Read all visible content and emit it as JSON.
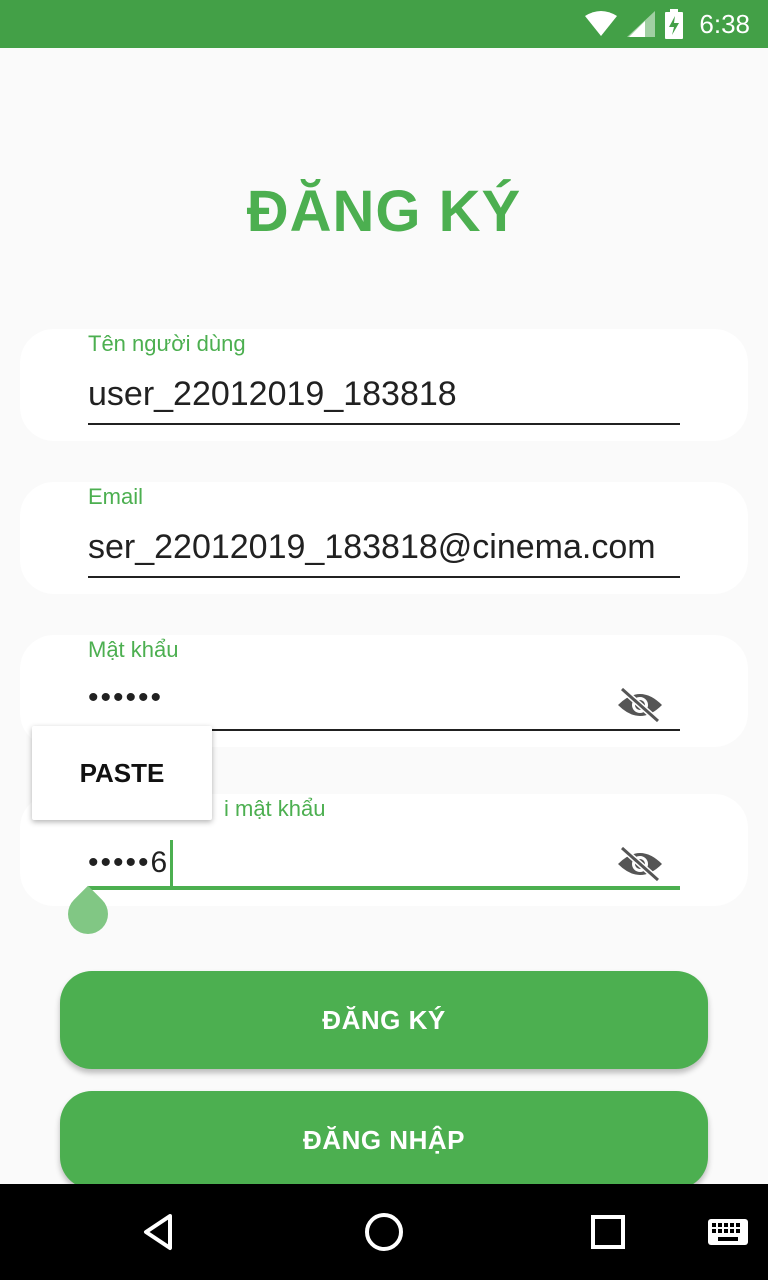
{
  "status_bar": {
    "time": "6:38",
    "icons": [
      "wifi-icon",
      "signal-icon",
      "battery-charging-icon"
    ],
    "color": "#43a047"
  },
  "page": {
    "title": "ĐĂNG KÝ",
    "accent": "#4caf50"
  },
  "form": {
    "username": {
      "label": "Tên người dùng",
      "value": "user_22012019_183818"
    },
    "email": {
      "label": "Email",
      "value": "ser_22012019_183818@cinema.com"
    },
    "password": {
      "label": "Mật khẩu",
      "value": "••••••"
    },
    "confirm_password": {
      "label_visible": "i mật khẩu",
      "value": "•••••6"
    }
  },
  "context_menu": {
    "paste_label": "PASTE"
  },
  "buttons": {
    "register": "ĐĂNG KÝ",
    "login": "ĐĂNG NHẬP"
  },
  "nav_bar": {
    "icons": [
      "back-icon",
      "home-icon",
      "recents-icon",
      "keyboard-icon"
    ]
  }
}
